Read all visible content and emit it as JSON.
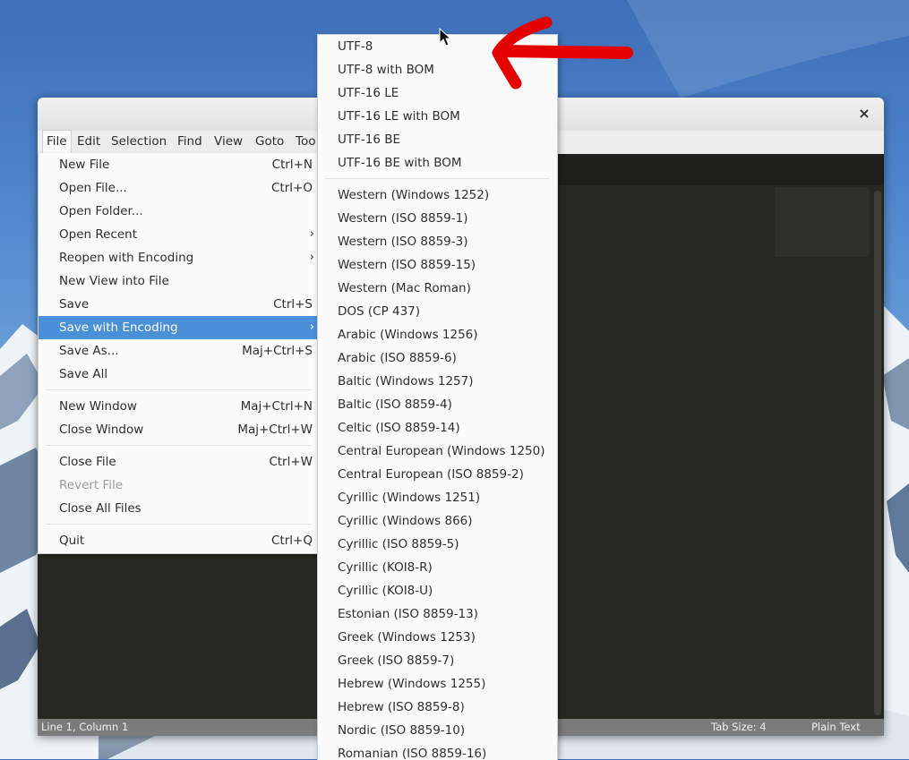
{
  "colors": {
    "menu_highlight": "#4a90d9",
    "editor_background": "#272822",
    "annotation_arrow": "#e50000"
  },
  "window": {
    "close_glyph": "×",
    "menubar": [
      "File",
      "Edit",
      "Selection",
      "Find",
      "View",
      "Goto",
      "Too"
    ]
  },
  "file_menu": {
    "highlighted": "Save with Encoding",
    "submenu_glyph": "›",
    "items": [
      {
        "label": "New File",
        "shortcut": "Ctrl+N"
      },
      {
        "label": "Open File...",
        "shortcut": "Ctrl+O"
      },
      {
        "label": "Open Folder...",
        "shortcut": ""
      },
      {
        "label": "Open Recent",
        "shortcut": ""
      },
      {
        "label": "Reopen with Encoding",
        "shortcut": ""
      },
      {
        "label": "New View into File",
        "shortcut": ""
      },
      {
        "label": "Save",
        "shortcut": "Ctrl+S"
      },
      {
        "label": "Save with Encoding",
        "shortcut": ""
      },
      {
        "label": "Save As...",
        "shortcut": "Maj+Ctrl+S"
      },
      {
        "label": "Save All",
        "shortcut": ""
      },
      {
        "label": "New Window",
        "shortcut": "Maj+Ctrl+N"
      },
      {
        "label": "Close Window",
        "shortcut": "Maj+Ctrl+W"
      },
      {
        "label": "Close File",
        "shortcut": "Ctrl+W"
      },
      {
        "label": "Revert File",
        "shortcut": "",
        "disabled": true
      },
      {
        "label": "Close All Files",
        "shortcut": ""
      },
      {
        "label": "Quit",
        "shortcut": "Ctrl+Q"
      }
    ]
  },
  "encoding_submenu": {
    "unicode": [
      "UTF-8",
      "UTF-8 with BOM",
      "UTF-16 LE",
      "UTF-16 LE with BOM",
      "UTF-16 BE",
      "UTF-16 BE with BOM"
    ],
    "others": [
      "Western (Windows 1252)",
      "Western (ISO 8859-1)",
      "Western (ISO 8859-3)",
      "Western (ISO 8859-15)",
      "Western (Mac Roman)",
      "DOS (CP 437)",
      "Arabic (Windows 1256)",
      "Arabic (ISO 8859-6)",
      "Baltic (Windows 1257)",
      "Baltic (ISO 8859-4)",
      "Celtic (ISO 8859-14)",
      "Central European (Windows 1250)",
      "Central European (ISO 8859-2)",
      "Cyrillic (Windows 1251)",
      "Cyrillic (Windows 866)",
      "Cyrillic (ISO 8859-5)",
      "Cyrillic (KOI8-R)",
      "Cyrillic (KOI8-U)",
      "Estonian (ISO 8859-13)",
      "Greek (Windows 1253)",
      "Greek (ISO 8859-7)",
      "Hebrew (Windows 1255)",
      "Hebrew (ISO 8859-8)",
      "Nordic (ISO 8859-10)",
      "Romanian (ISO 8859-16)"
    ]
  },
  "status_bar": {
    "position": "Line 1, Column 1",
    "tab_size": "Tab Size: 4",
    "syntax": "Plain Text"
  }
}
